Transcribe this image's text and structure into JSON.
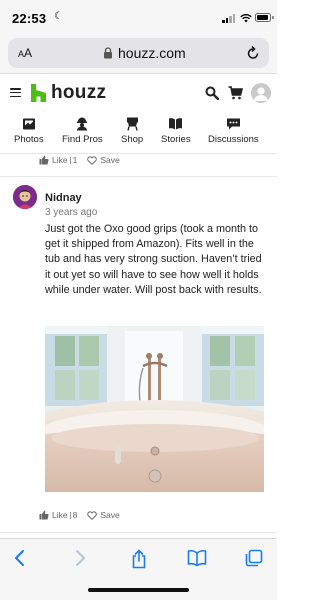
{
  "status": {
    "time": "22:53"
  },
  "browser": {
    "url": "houzz.com",
    "aa_label_small": "A",
    "aa_label_large": "A"
  },
  "header": {
    "logo_text": "houzz"
  },
  "nav": [
    {
      "label": "Photos",
      "icon": "photos-icon"
    },
    {
      "label": "Find Pros",
      "icon": "find-pros-icon"
    },
    {
      "label": "Shop",
      "icon": "shop-icon"
    },
    {
      "label": "Stories",
      "icon": "stories-icon"
    },
    {
      "label": "Discussions",
      "icon": "discussions-icon"
    }
  ],
  "prev_comment": {
    "like_label": "Like",
    "like_count": "1",
    "save_label": "Save"
  },
  "comment": {
    "author": "Nidnay",
    "time": "3 years ago",
    "body": "Just got the Oxo good grips (took a month to get it shipped from Amazon). Fits well in the tub and has very strong suction. Haven’t tried it out yet so will have to see how well it holds while under water. Will post back with results.",
    "like_label": "Like",
    "like_count": "8",
    "save_label": "Save"
  },
  "colors": {
    "brand": "#4dbc15",
    "ios_blue": "#1a7cf5"
  }
}
